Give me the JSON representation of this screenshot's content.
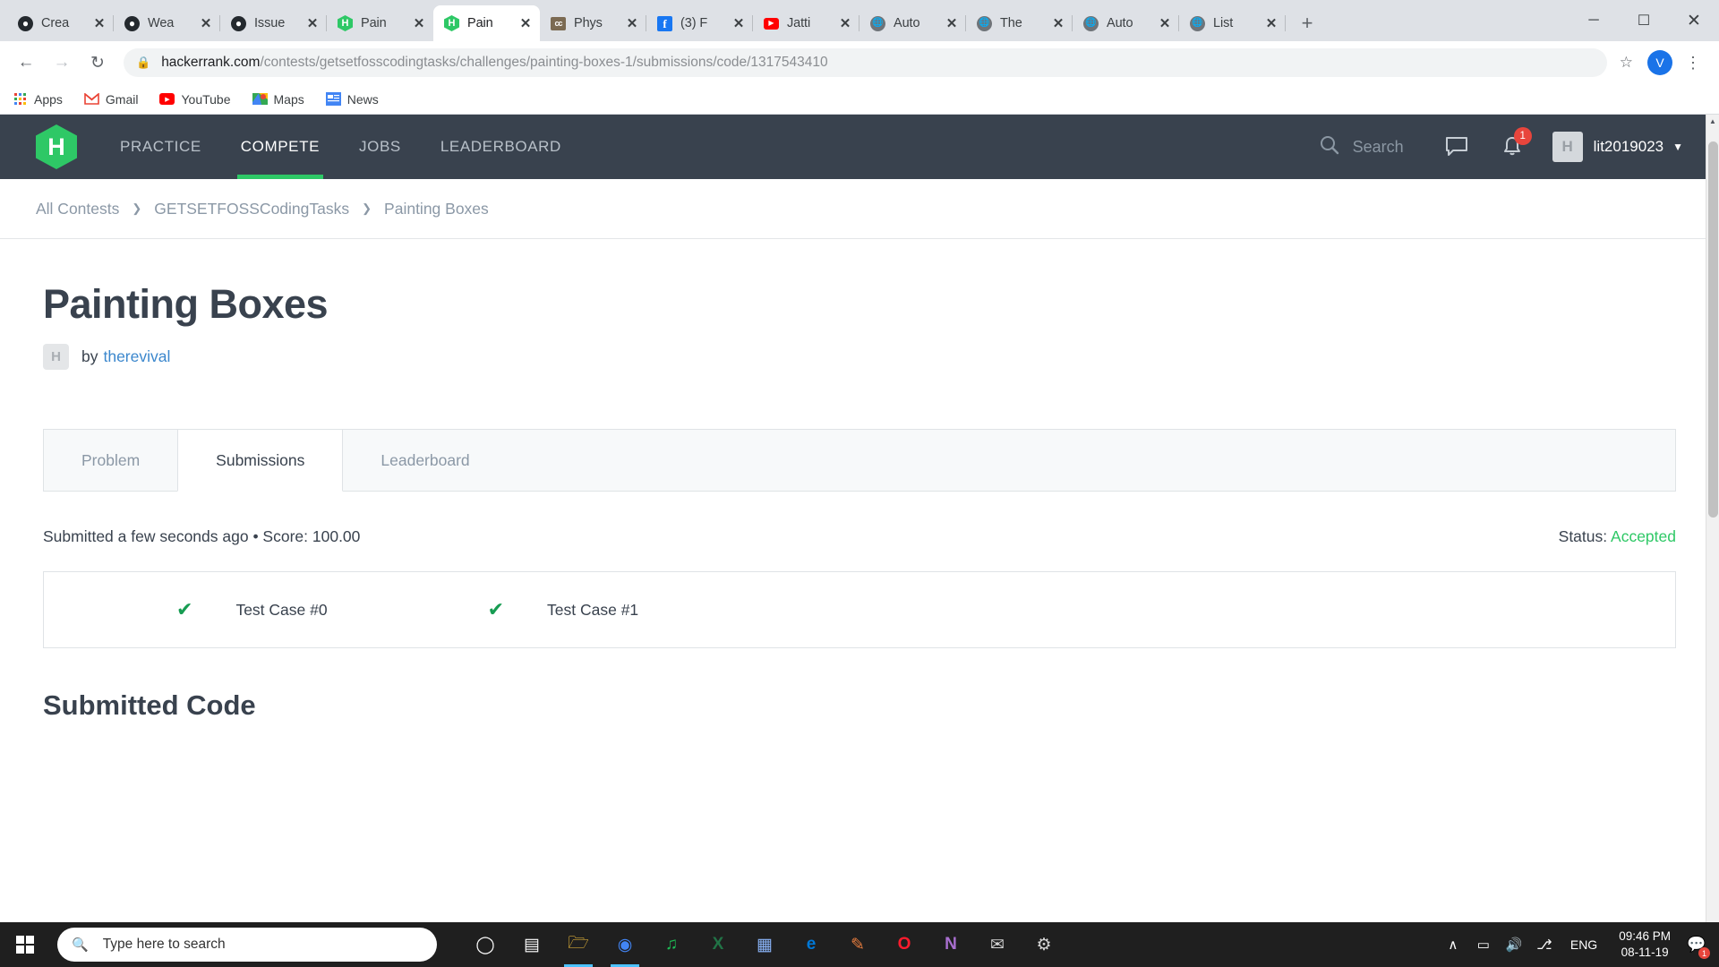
{
  "browser": {
    "tabs": [
      {
        "title": "Crea",
        "favicon": "github-icon",
        "active": false
      },
      {
        "title": "Wea",
        "favicon": "github-icon",
        "active": false
      },
      {
        "title": "Issue",
        "favicon": "github-icon",
        "active": false
      },
      {
        "title": "Pain",
        "favicon": "hackerrank-icon",
        "active": false
      },
      {
        "title": "Pain",
        "favicon": "hackerrank-icon",
        "active": true
      },
      {
        "title": "Phys",
        "favicon": "coursera-icon",
        "active": false
      },
      {
        "title": "(3) F",
        "favicon": "facebook-icon",
        "active": false
      },
      {
        "title": "Jatti",
        "favicon": "youtube-icon",
        "active": false
      },
      {
        "title": "Auto",
        "favicon": "globe-icon",
        "active": false
      },
      {
        "title": "The",
        "favicon": "globe-icon",
        "active": false
      },
      {
        "title": "Auto",
        "favicon": "globe-icon",
        "active": false
      },
      {
        "title": "List",
        "favicon": "globe-icon",
        "active": false
      }
    ],
    "new_tab_label": "+",
    "window_controls": {
      "minimize": "─",
      "maximize": "☐",
      "close": "✕"
    },
    "url_domain": "hackerrank.com",
    "url_path": "/contests/getsetfosscodingtasks/challenges/painting-boxes-1/submissions/code/1317543410",
    "profile_initial": "V",
    "bookmarks": [
      {
        "label": "Apps",
        "icon": "apps-grid-icon"
      },
      {
        "label": "Gmail",
        "icon": "gmail-icon"
      },
      {
        "label": "YouTube",
        "icon": "youtube-icon"
      },
      {
        "label": "Maps",
        "icon": "maps-icon"
      },
      {
        "label": "News",
        "icon": "news-icon"
      }
    ]
  },
  "site_nav": {
    "logo_letter": "H",
    "links": [
      {
        "label": "PRACTICE",
        "active": false
      },
      {
        "label": "COMPETE",
        "active": true
      },
      {
        "label": "JOBS",
        "active": false
      },
      {
        "label": "LEADERBOARD",
        "active": false
      }
    ],
    "search_placeholder": "Search",
    "notification_count": "1",
    "username": "lit2019023",
    "avatar_letter": "H"
  },
  "breadcrumb": [
    "All Contests",
    "GETSETFOSSCodingTasks",
    "Painting Boxes"
  ],
  "challenge": {
    "title": "Painting Boxes",
    "by_label": "by",
    "author": "therevival",
    "author_avatar_letter": "H"
  },
  "tabs": [
    {
      "label": "Problem",
      "active": false
    },
    {
      "label": "Submissions",
      "active": true
    },
    {
      "label": "Leaderboard",
      "active": false
    }
  ],
  "submission": {
    "submitted_text": "Submitted a few seconds ago • Score: 100.00",
    "status_label": "Status:",
    "status_value": "Accepted",
    "status_color": "#2ec866",
    "test_cases": [
      {
        "label": "Test Case #0",
        "passed": true
      },
      {
        "label": "Test Case #1",
        "passed": true
      }
    ],
    "code_heading": "Submitted Code"
  },
  "taskbar": {
    "search_placeholder": "Type here to search",
    "apps": [
      {
        "name": "cortana-icon",
        "glyph": "○",
        "color": "#ffffff",
        "active": false
      },
      {
        "name": "task-view-icon",
        "glyph": "⌸",
        "color": "#ffffff",
        "active": false
      },
      {
        "name": "file-explorer-icon",
        "glyph": "🗀",
        "color": "#ffc83d",
        "active": true
      },
      {
        "name": "chrome-icon",
        "glyph": "◉",
        "color": "#4285f4",
        "active": true
      },
      {
        "name": "spotify-icon",
        "glyph": "♫",
        "color": "#1db954",
        "active": false
      },
      {
        "name": "excel-icon",
        "glyph": "X",
        "color": "#217346",
        "active": false
      },
      {
        "name": "photos-icon",
        "glyph": "▦",
        "color": "#8ab4f8",
        "active": false
      },
      {
        "name": "edge-icon",
        "glyph": "e",
        "color": "#0078d7",
        "active": false
      },
      {
        "name": "paint-icon",
        "glyph": "✎",
        "color": "#e87d3e",
        "active": false
      },
      {
        "name": "opera-icon",
        "glyph": "O",
        "color": "#ff1b2d",
        "active": false
      },
      {
        "name": "onenote-icon",
        "glyph": "N",
        "color": "#7719aa",
        "active": false
      },
      {
        "name": "mail-icon",
        "glyph": "✉",
        "color": "#d4d4d4",
        "active": false
      },
      {
        "name": "settings-icon",
        "glyph": "⚙",
        "color": "#d4d4d4",
        "active": false
      }
    ],
    "tray": {
      "chevron": "∧",
      "battery": "▭",
      "volume": "🔊",
      "network": "⎇",
      "language": "ENG",
      "time": "09:46 PM",
      "date": "08-11-19",
      "notification_count": "1"
    }
  }
}
